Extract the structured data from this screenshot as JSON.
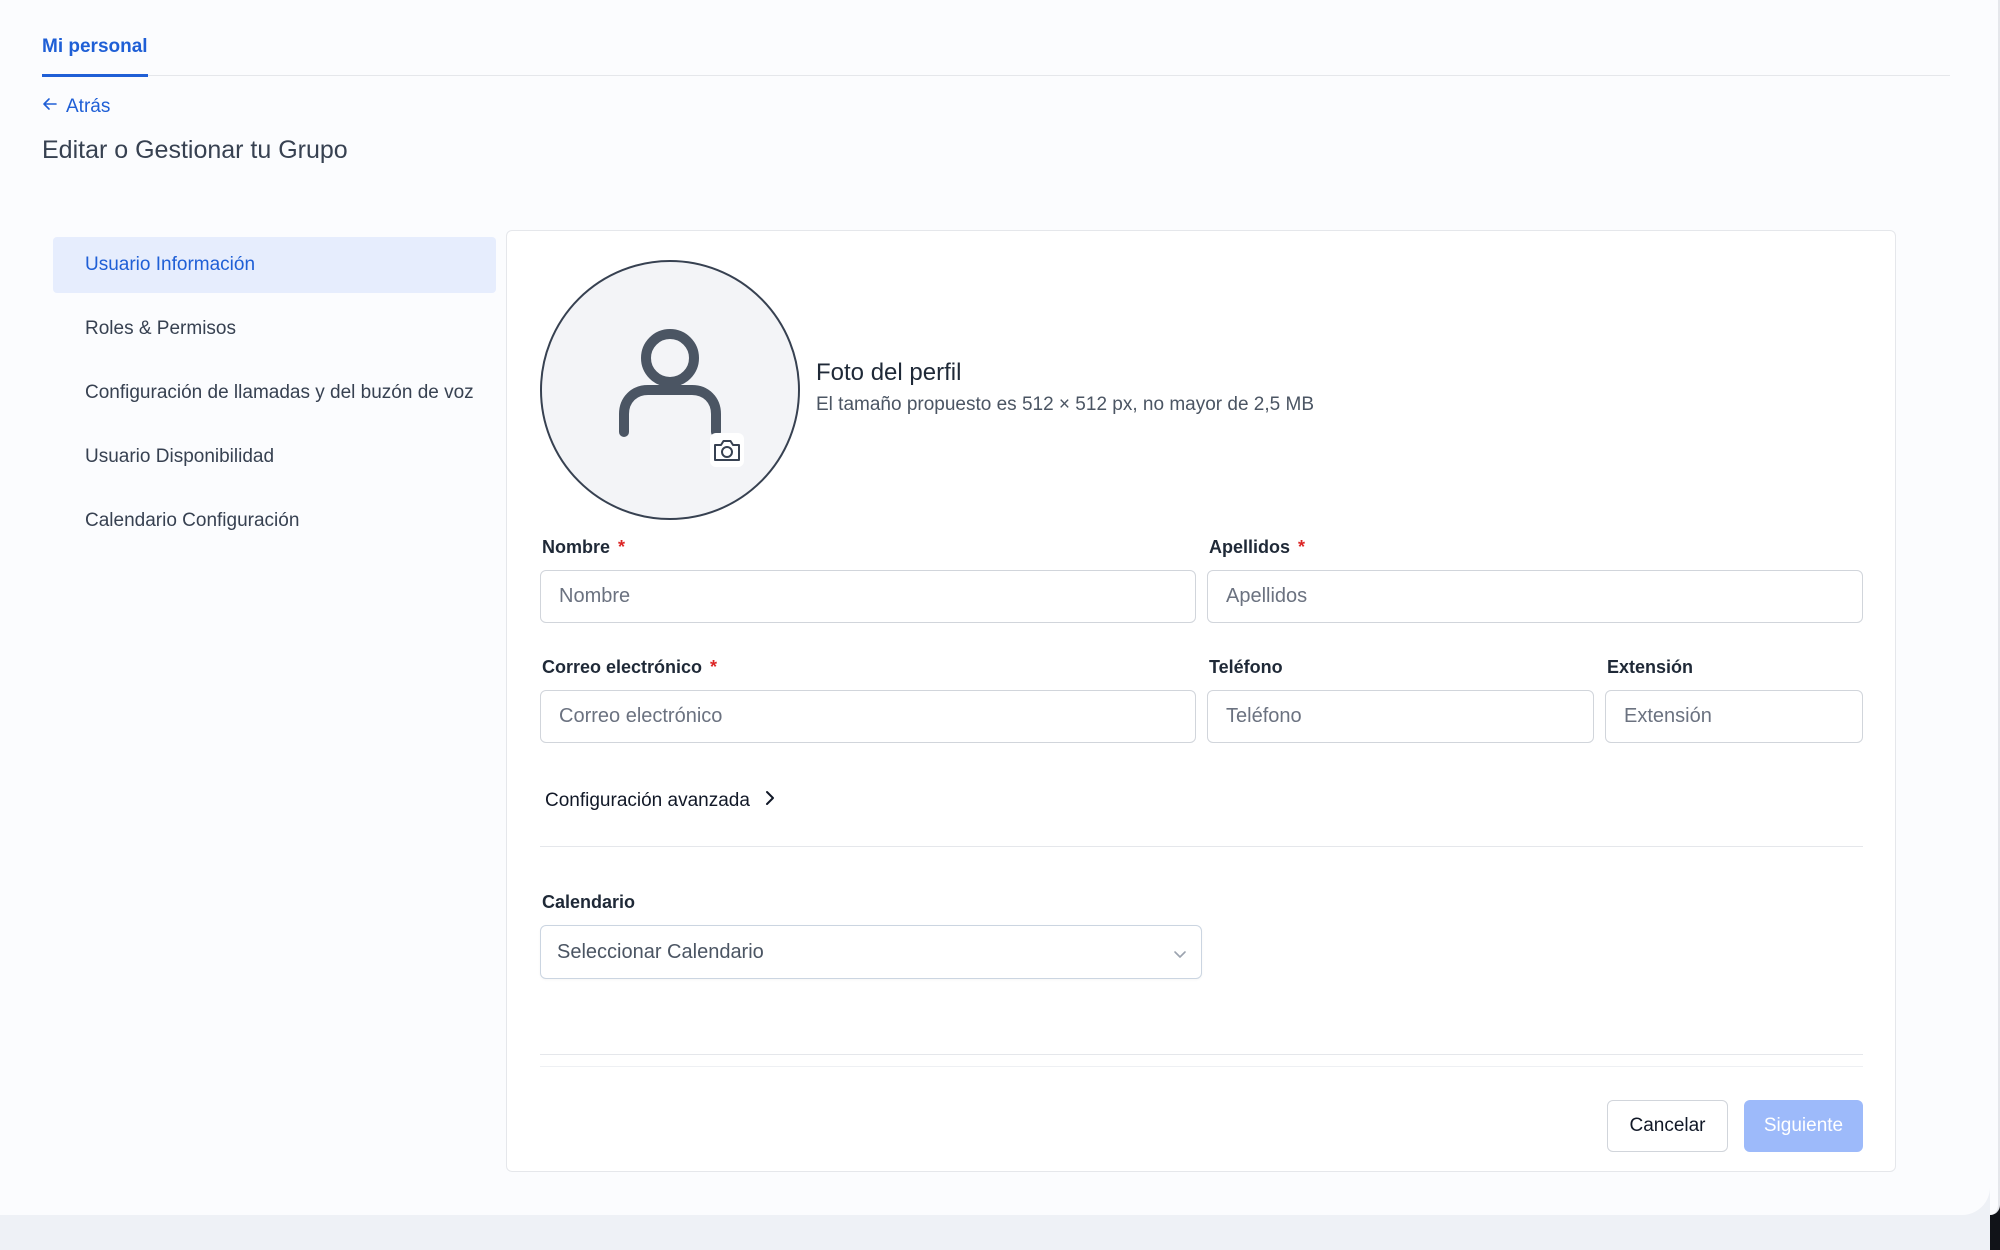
{
  "tabs": {
    "active_label": "Mi personal"
  },
  "header": {
    "back_label": "Atrás",
    "title": "Editar o Gestionar tu Grupo"
  },
  "sidebar": {
    "items": [
      {
        "label": "Usuario Información",
        "active": true
      },
      {
        "label": "Roles & Permisos",
        "active": false
      },
      {
        "label": "Configuración de llamadas y del buzón de voz",
        "active": false
      },
      {
        "label": "Usuario Disponibilidad",
        "active": false
      },
      {
        "label": "Calendario Configuración",
        "active": false
      }
    ]
  },
  "profile": {
    "title": "Foto del perfil",
    "hint": "El tamaño propuesto es 512 × 512 px, no mayor de 2,5 MB",
    "avatar_icon": "user-icon",
    "upload_icon": "camera-icon"
  },
  "form": {
    "first_name": {
      "label": "Nombre",
      "required_mark": "*",
      "placeholder": "Nombre",
      "value": ""
    },
    "last_name": {
      "label": "Apellidos",
      "required_mark": "*",
      "placeholder": "Apellidos",
      "value": ""
    },
    "email": {
      "label": "Correo electrónico",
      "required_mark": "*",
      "placeholder": "Correo electrónico",
      "value": ""
    },
    "phone": {
      "label": "Teléfono",
      "placeholder": "Teléfono",
      "value": ""
    },
    "extension": {
      "label": "Extensión",
      "placeholder": "Extensión",
      "value": ""
    },
    "advanced_label": "Configuración avanzada",
    "calendar": {
      "label": "Calendario",
      "placeholder": "Seleccionar Calendario"
    }
  },
  "footer": {
    "cancel_label": "Cancelar",
    "next_label": "Siguiente"
  },
  "colors": {
    "accent": "#1f5fd6",
    "active_bg": "#e6edfd",
    "required": "#dc2626",
    "next_disabled": "#9dbafa"
  }
}
